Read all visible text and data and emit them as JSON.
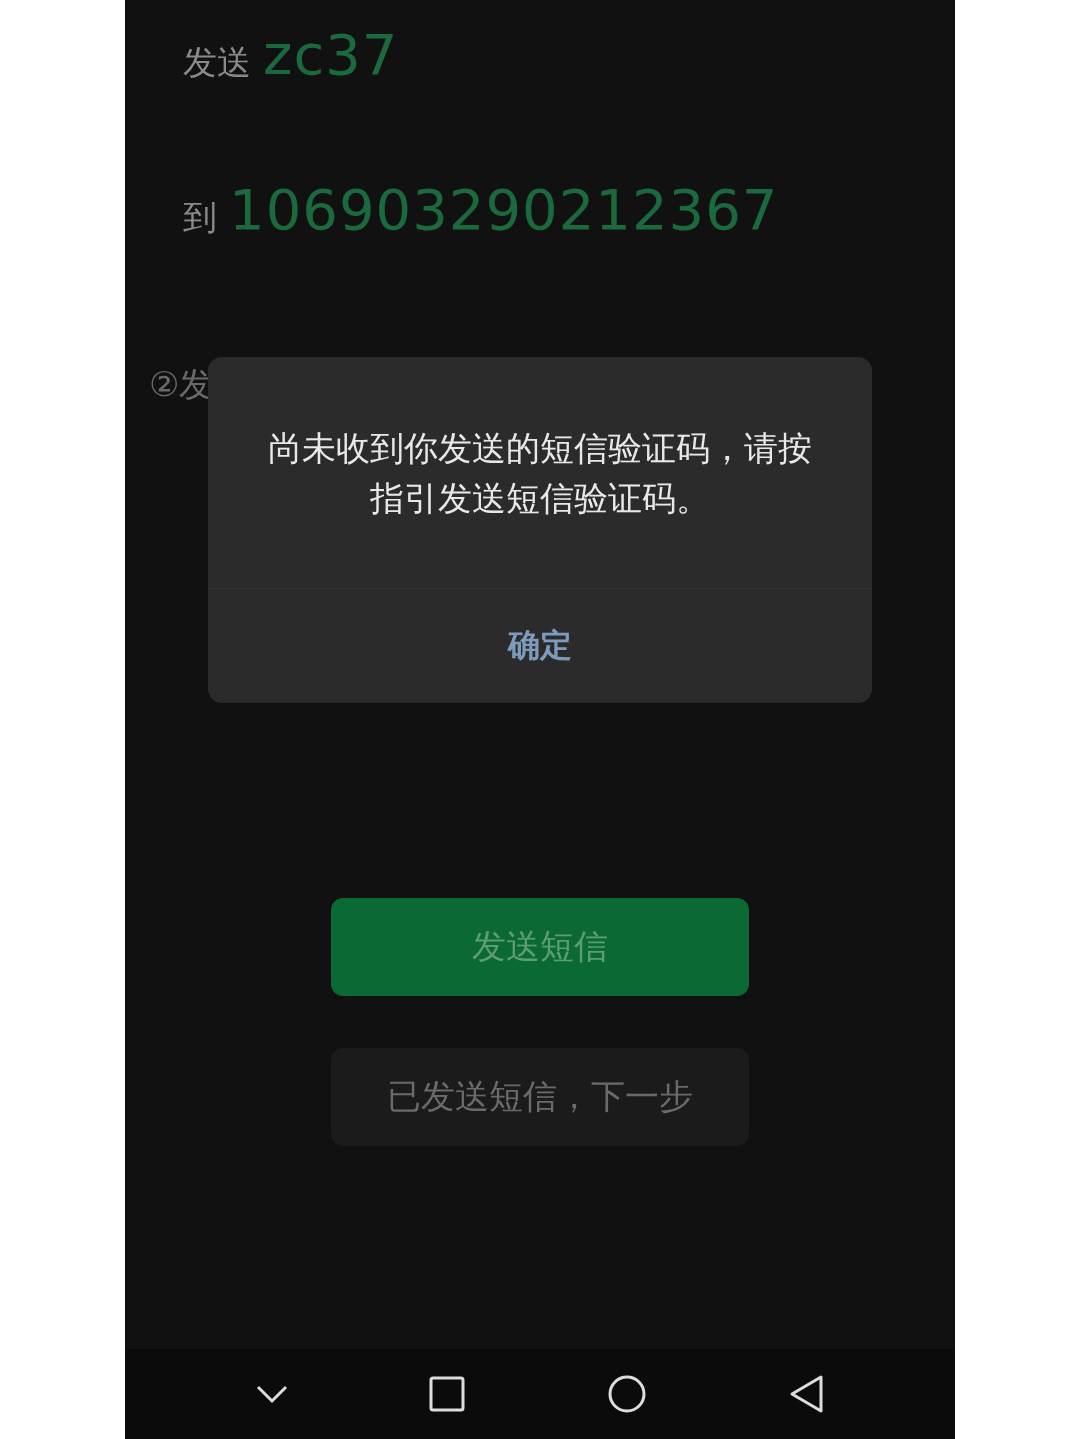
{
  "send_row": {
    "label": "发送",
    "value": "zc37"
  },
  "to_row": {
    "label": "到",
    "value": "106903290212367"
  },
  "step_text": "②发",
  "buttons": [
    {
      "label": "发送短信",
      "kind": "primary"
    },
    {
      "label": "已发送短信，下一步",
      "kind": "secondary"
    }
  ],
  "dialog": {
    "message": "尚未收到你发送的短信验证码，请按指引发送短信验证码。",
    "confirm": "确定"
  },
  "nav_bar": [
    {
      "kind": "collapse"
    },
    {
      "kind": "recents"
    },
    {
      "kind": "home"
    },
    {
      "kind": "back"
    }
  ]
}
